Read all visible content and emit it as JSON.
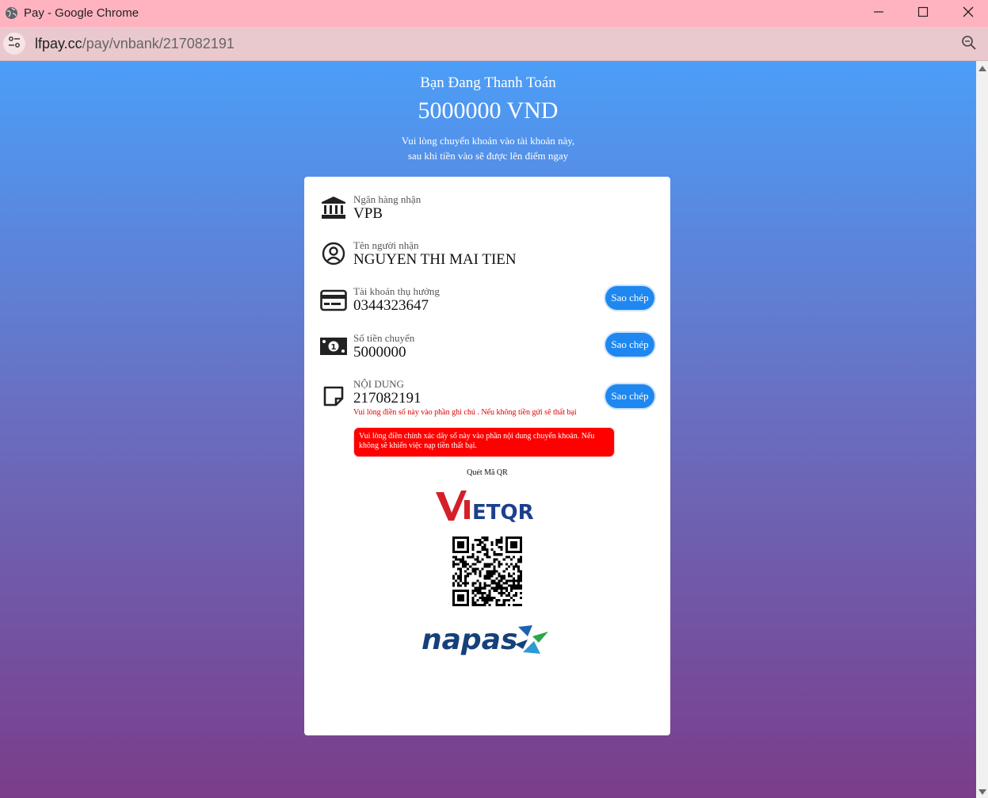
{
  "browser": {
    "window_title": "Pay - Google Chrome",
    "url_domain": "lfpay.cc",
    "url_path": "/pay/vnbank/217082191"
  },
  "page": {
    "title": "Bạn Đang Thanh Toán",
    "amount": "5000000 VND",
    "note_line1": "Vui lòng chuyển khoản vào tài khoản này,",
    "note_line2": "sau khi tiền vào sẽ được lên điểm ngay"
  },
  "payment": {
    "bank": {
      "label": "Ngân hàng nhận",
      "value": "VPB",
      "icon": "bank-icon"
    },
    "receiver": {
      "label": "Tên người nhận",
      "value": "NGUYEN THI MAI TIEN",
      "icon": "user-circle-icon"
    },
    "account": {
      "label": "Tài khoản thụ hưởng",
      "value": "0344323647",
      "icon": "credit-card-icon",
      "button": "Sao chép"
    },
    "amount": {
      "label": "Số tiền chuyển",
      "value": "5000000",
      "icon": "money-bill-icon",
      "button": "Sao chép"
    },
    "content": {
      "label": "NỘI DUNG",
      "value": "217082191",
      "icon": "note-icon",
      "button": "Sao chép"
    }
  },
  "hint": "Vui lòng điền số này vào phần ghi chú . Nếu không tiền gửi sẽ thất bại",
  "warning": "Vui lòng điền chính xác dãy số này vào phần nội dung chuyển khoản. Nếu không sẽ khiến việc nạp tiền thất bại.",
  "qr": {
    "label": "Quét Mã QR",
    "vietqr_logo": "VIETQR",
    "napas_logo": "napas"
  },
  "colors": {
    "gradient_top": "#4b9ef8",
    "gradient_bottom": "#7a3d8a",
    "copy_button": "#1e88f0",
    "warning": "#ff0000",
    "vietqr_red": "#d4202a",
    "vietqr_blue": "#1d3f8f",
    "napas_blue": "#15407a"
  }
}
